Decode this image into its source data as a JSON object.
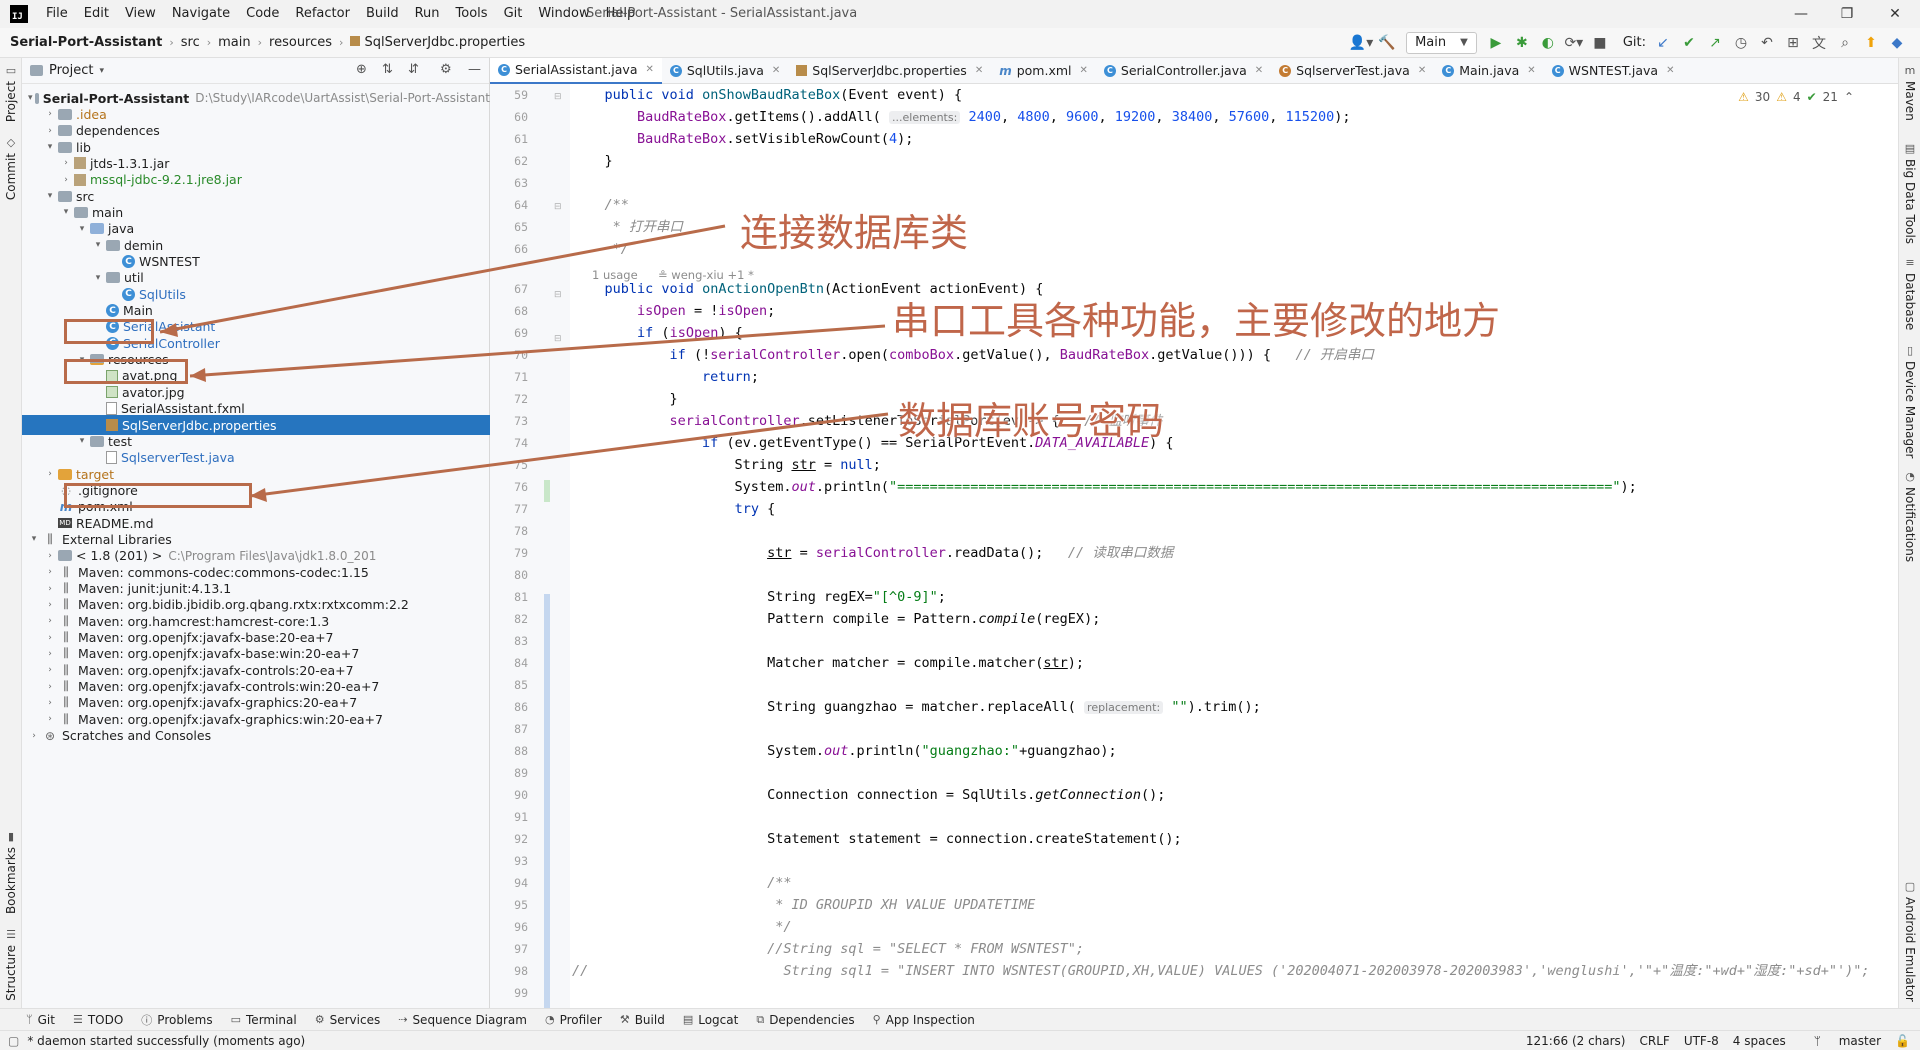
{
  "app": {
    "logo": "IJ",
    "window_title": "Serial-Port-Assistant - SerialAssistant.java",
    "menu": [
      "File",
      "Edit",
      "View",
      "Navigate",
      "Code",
      "Refactor",
      "Build",
      "Run",
      "Tools",
      "Git",
      "Window",
      "Help"
    ],
    "minimize": "—",
    "maximize": "❐",
    "close": "✕"
  },
  "breadcrumb": {
    "root": "Serial-Port-Assistant",
    "items": [
      "src",
      "main",
      "resources",
      "SqlServerJdbc.properties"
    ]
  },
  "toolbar": {
    "user_icon": "user-icon",
    "run_config": "Main",
    "git_label": "Git:"
  },
  "left_strip": {
    "project": "Project",
    "commit": "Commit",
    "bookmarks": "Bookmarks",
    "structure": "Structure"
  },
  "right_strip": {
    "maven": "Maven",
    "big_data_tools": "Big Data Tools",
    "database": "Database",
    "device_manager": "Device Manager",
    "notifications": "Notifications",
    "android_emulator": "Android Emulator"
  },
  "project_panel": {
    "title": "Project",
    "tree": [
      {
        "label": "Serial-Port-Assistant",
        "path": "D:\\Study\\IARcode\\UartAssist\\Serial-Port-Assistant",
        "icon": "folder-icon",
        "indent": 0,
        "arrow": "▾",
        "bold": true
      },
      {
        "label": ".idea",
        "icon": "folder-icon",
        "indent": 1,
        "arrow": "›",
        "color": "orange"
      },
      {
        "label": "dependences",
        "icon": "folder-icon",
        "indent": 1,
        "arrow": "›"
      },
      {
        "label": "lib",
        "icon": "folder-icon",
        "indent": 1,
        "arrow": "▾"
      },
      {
        "label": "jtds-1.3.1.jar",
        "icon": "jar-icon",
        "indent": 2,
        "arrow": "›"
      },
      {
        "label": "mssql-jdbc-9.2.1.jre8.jar",
        "icon": "jar-icon",
        "indent": 2,
        "arrow": "›",
        "color": "green"
      },
      {
        "label": "src",
        "icon": "folder-icon",
        "indent": 1,
        "arrow": "▾"
      },
      {
        "label": "main",
        "icon": "folder-icon",
        "indent": 2,
        "arrow": "▾"
      },
      {
        "label": "java",
        "icon": "source-folder-icon",
        "indent": 3,
        "arrow": "▾"
      },
      {
        "label": "demin",
        "icon": "package-icon",
        "indent": 4,
        "arrow": "▾"
      },
      {
        "label": "WSNTEST",
        "icon": "class-icon",
        "indent": 5,
        "arrow": ""
      },
      {
        "label": "util",
        "icon": "package-icon",
        "indent": 4,
        "arrow": "▾"
      },
      {
        "label": "SqlUtils",
        "icon": "class-icon",
        "indent": 5,
        "arrow": "",
        "color": "blue"
      },
      {
        "label": "Main",
        "icon": "class-icon",
        "indent": 4,
        "arrow": ""
      },
      {
        "label": "SerialAssistant",
        "icon": "class-icon",
        "indent": 4,
        "arrow": "",
        "color": "blue"
      },
      {
        "label": "SerialController",
        "icon": "class-icon",
        "indent": 4,
        "arrow": "",
        "color": "blue"
      },
      {
        "label": "resources",
        "icon": "resources-folder-icon",
        "indent": 3,
        "arrow": "▾"
      },
      {
        "label": "avat.png",
        "icon": "image-icon",
        "indent": 4,
        "arrow": ""
      },
      {
        "label": "avator.jpg",
        "icon": "image-icon",
        "indent": 4,
        "arrow": ""
      },
      {
        "label": "SerialAssistant.fxml",
        "icon": "fxml-icon",
        "indent": 4,
        "arrow": ""
      },
      {
        "label": "SqlServerJdbc.properties",
        "icon": "properties-icon",
        "indent": 4,
        "arrow": "",
        "selected": true
      },
      {
        "label": "test",
        "icon": "folder-icon",
        "indent": 3,
        "arrow": "▾"
      },
      {
        "label": "SqlserverTest.java",
        "icon": "java-file-icon",
        "indent": 4,
        "arrow": "",
        "color": "blue"
      },
      {
        "label": "target",
        "icon": "folder-icon",
        "indent": 1,
        "arrow": "›",
        "color": "orange",
        "orange_folder": true
      },
      {
        "label": ".gitignore",
        "icon": "git-icon",
        "indent": 1,
        "arrow": ""
      },
      {
        "label": "pom.xml",
        "icon": "maven-icon",
        "indent": 1,
        "arrow": ""
      },
      {
        "label": "README.md",
        "icon": "markdown-icon",
        "indent": 1,
        "arrow": ""
      },
      {
        "label": "External Libraries",
        "icon": "library-icon",
        "indent": 0,
        "arrow": "▾"
      },
      {
        "label": "< 1.8 (201) >",
        "path": "C:\\Program Files\\Java\\jdk1.8.0_201",
        "icon": "sdk-icon",
        "indent": 1,
        "arrow": "›"
      },
      {
        "label": "Maven: commons-codec:commons-codec:1.15",
        "icon": "library-icon",
        "indent": 1,
        "arrow": "›"
      },
      {
        "label": "Maven: junit:junit:4.13.1",
        "icon": "library-icon",
        "indent": 1,
        "arrow": "›"
      },
      {
        "label": "Maven: org.bidib.jbidib.org.qbang.rxtx:rxtxcomm:2.2",
        "icon": "library-icon",
        "indent": 1,
        "arrow": "›"
      },
      {
        "label": "Maven: org.hamcrest:hamcrest-core:1.3",
        "icon": "library-icon",
        "indent": 1,
        "arrow": "›"
      },
      {
        "label": "Maven: org.openjfx:javafx-base:20-ea+7",
        "icon": "library-icon",
        "indent": 1,
        "arrow": "›"
      },
      {
        "label": "Maven: org.openjfx:javafx-base:win:20-ea+7",
        "icon": "library-icon",
        "indent": 1,
        "arrow": "›"
      },
      {
        "label": "Maven: org.openjfx:javafx-controls:20-ea+7",
        "icon": "library-icon",
        "indent": 1,
        "arrow": "›"
      },
      {
        "label": "Maven: org.openjfx:javafx-controls:win:20-ea+7",
        "icon": "library-icon",
        "indent": 1,
        "arrow": "›"
      },
      {
        "label": "Maven: org.openjfx:javafx-graphics:20-ea+7",
        "icon": "library-icon",
        "indent": 1,
        "arrow": "›"
      },
      {
        "label": "Maven: org.openjfx:javafx-graphics:win:20-ea+7",
        "icon": "library-icon",
        "indent": 1,
        "arrow": "›"
      },
      {
        "label": "Scratches and Consoles",
        "icon": "scratches-icon",
        "indent": 0,
        "arrow": "›"
      }
    ]
  },
  "editor_tabs": [
    {
      "label": "SerialAssistant.java",
      "icon": "class-icon",
      "active": true
    },
    {
      "label": "SqlUtils.java",
      "icon": "class-icon"
    },
    {
      "label": "SqlServerJdbc.properties",
      "icon": "properties-icon"
    },
    {
      "label": "pom.xml",
      "icon": "maven-icon"
    },
    {
      "label": "SerialController.java",
      "icon": "class-icon"
    },
    {
      "label": "SqlserverTest.java",
      "icon": "java-file-icon"
    },
    {
      "label": "Main.java",
      "icon": "class-icon"
    },
    {
      "label": "WSNTEST.java",
      "icon": "class-icon"
    }
  ],
  "inspection": {
    "warnings": "30",
    "weak_warnings": "4",
    "ok": "21"
  },
  "code_hints": {
    "usage": "1 usage",
    "author": "weng-xiu +1 *"
  },
  "code_lines": [
    {
      "n": "59",
      "html": "    <span class=\"kw\">public void</span> <span class=\"fn\">onShowBaudRateBox</span>(Event event) {"
    },
    {
      "n": "60",
      "html": "        <span class=\"fld\">BaudRateBox</span>.getItems().addAll( <span class=\"inlay\">...elements:</span> <span class=\"num\">2400</span>, <span class=\"num\">4800</span>, <span class=\"num\">9600</span>, <span class=\"num\">19200</span>, <span class=\"num\">38400</span>, <span class=\"num\">57600</span>, <span class=\"num\">115200</span>);"
    },
    {
      "n": "61",
      "html": "        <span class=\"fld\">BaudRateBox</span>.setVisibleRowCount(<span class=\"num\">4</span>);"
    },
    {
      "n": "62",
      "html": "    }"
    },
    {
      "n": "63",
      "html": ""
    },
    {
      "n": "64",
      "html": "    <span class=\"cmt\">/**</span>"
    },
    {
      "n": "65",
      "html": "<span class=\"cmt\">     * 打开串口</span>"
    },
    {
      "n": "66",
      "html": "<span class=\"cmt\">     */</span>"
    },
    {
      "n": "67",
      "html": "    <span class=\"kw\">public void</span> <span class=\"fn\">onActionOpenBtn</span>(ActionEvent actionEvent) {"
    },
    {
      "n": "68",
      "html": "        <span class=\"fld\">isOpen</span> = !<span class=\"fld\">isOpen</span>;"
    },
    {
      "n": "69",
      "html": "        <span class=\"kw\">if</span> (<span class=\"fld\">isOpen</span>) {"
    },
    {
      "n": "70",
      "html": "            <span class=\"kw\">if</span> (!<span class=\"fld\">serialController</span>.open(<span class=\"fld\">comboBox</span>.getValue(), <span class=\"fld\">BaudRateBox</span>.getValue())) {   <span class=\"cmt\">// 开启串口</span>"
    },
    {
      "n": "71",
      "html": "                <span class=\"kw\">return</span>;"
    },
    {
      "n": "72",
      "html": "            }"
    },
    {
      "n": "73",
      "html": "            <span class=\"fld\">serialController</span>.setListenerToSerialPort(ev -> {   <span class=\"cmt\">// 监听事件</span>"
    },
    {
      "n": "74",
      "html": "                <span class=\"kw\">if</span> (ev.getEventType() == SerialPortEvent.<span class=\"fld\"><i>DATA_AVAILABLE</i></span>) {"
    },
    {
      "n": "75",
      "html": "                    String <u>str</u> = <span class=\"kw\">null</span>;"
    },
    {
      "n": "76",
      "html": "                    System.<span class=\"fld\"><i>out</i></span>.println(<span class=\"str\">\"========================================================================================\"</span>);"
    },
    {
      "n": "77",
      "html": "                    <span class=\"kw\">try</span> {"
    },
    {
      "n": "78",
      "html": ""
    },
    {
      "n": "79",
      "html": "                        <u>str</u> = <span class=\"fld\">serialController</span>.readData();   <span class=\"cmt\">// 读取串口数据</span>"
    },
    {
      "n": "80",
      "html": ""
    },
    {
      "n": "81",
      "html": "                        String regEX=<span class=\"str\">\"[^0-9]\"</span>;"
    },
    {
      "n": "82",
      "html": "                        Pattern compile = Pattern.<i>compile</i>(regEX);"
    },
    {
      "n": "83",
      "html": ""
    },
    {
      "n": "84",
      "html": "                        Matcher matcher = compile.matcher(<u>str</u>);"
    },
    {
      "n": "85",
      "html": ""
    },
    {
      "n": "86",
      "html": "                        String guangzhao = matcher.replaceAll( <span class=\"inlay\">replacement:</span> <span class=\"str\">\"\"</span>).trim();"
    },
    {
      "n": "87",
      "html": ""
    },
    {
      "n": "88",
      "html": "                        System.<span class=\"fld\"><i>out</i></span>.println(<span class=\"str\">\"guangzhao:\"</span>+guangzhao);"
    },
    {
      "n": "89",
      "html": ""
    },
    {
      "n": "90",
      "html": "                        Connection connection = SqlUtils.<i>getConnection</i>();"
    },
    {
      "n": "91",
      "html": ""
    },
    {
      "n": "92",
      "html": "                        Statement statement = connection.createStatement();"
    },
    {
      "n": "93",
      "html": ""
    },
    {
      "n": "94",
      "html": "                        <span class=\"cmt\">/**</span>"
    },
    {
      "n": "95",
      "html": "<span class=\"cmt\">                         * ID GROUPID XH VALUE UPDATETIME</span>"
    },
    {
      "n": "96",
      "html": "<span class=\"cmt\">                         */</span>"
    },
    {
      "n": "97",
      "html": "                        <span class=\"cmt\">//String sql = \"SELECT * FROM WSNTEST\";</span>"
    },
    {
      "n": "98",
      "html": "<span class=\"cmt\">//                        String sql1 = \"INSERT INTO WSNTEST(GROUPID,XH,VALUE) VALUES ('202004071-202003978-202003983','wenglushi','\"+\"温度:\"+wd+\"湿度:\"+sd+\"')\";</span>"
    },
    {
      "n": "99",
      "html": ""
    }
  ],
  "annotations": {
    "db_class": "连接数据库类",
    "serial_features": "串口工具各种功能，主要修改的地方",
    "db_credentials": "数据库账号密码"
  },
  "bottom_tools": [
    "Git",
    "TODO",
    "Problems",
    "Terminal",
    "Services",
    "Sequence Diagram",
    "Profiler",
    "Build",
    "Logcat",
    "Dependencies",
    "App Inspection"
  ],
  "status": {
    "message": "* daemon started successfully (moments ago)",
    "position": "121:66 (2 chars)",
    "line_sep": "CRLF",
    "encoding": "UTF-8",
    "indent": "4 spaces",
    "branch": "master"
  },
  "colors": {
    "accent": "#2675bf",
    "annotation": "#c0664a",
    "annotation_box": "#b86b4a"
  }
}
